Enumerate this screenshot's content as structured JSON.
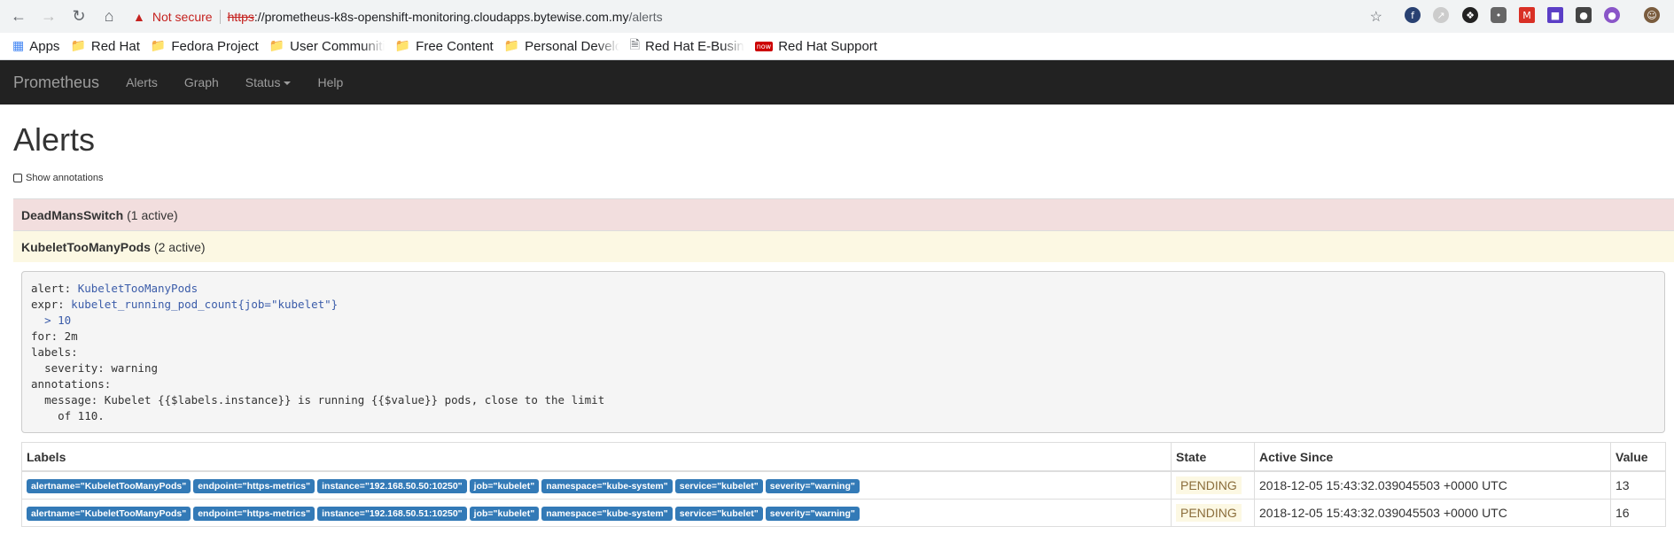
{
  "browser": {
    "warning_icon": "warning-triangle-icon",
    "not_secure": "Not secure",
    "url_scheme": "https",
    "url_host": "://prometheus-k8s-openshift-monitoring.cloudapps.bytewise.com.my",
    "url_path": "/alerts"
  },
  "bookmarks": [
    {
      "label": "Apps",
      "icon": "apps-grid-icon"
    },
    {
      "label": "Red Hat",
      "icon": "folder-icon"
    },
    {
      "label": "Fedora Project",
      "icon": "folder-icon"
    },
    {
      "label": "User Communiti",
      "icon": "folder-icon"
    },
    {
      "label": "Free Content",
      "icon": "folder-icon"
    },
    {
      "label": "Personal Develop",
      "icon": "folder-icon"
    },
    {
      "label": "Red Hat E-Busin",
      "icon": "page-icon"
    },
    {
      "label": "Red Hat Support",
      "icon": "redhat-now-icon"
    }
  ],
  "navbar": {
    "brand": "Prometheus",
    "links": [
      "Alerts",
      "Graph",
      "Status",
      "Help"
    ]
  },
  "page": {
    "title": "Alerts",
    "show_annotations": "Show annotations"
  },
  "groups": [
    {
      "name": "DeadMansSwitch",
      "count": "(1 active)"
    },
    {
      "name": "KubeletTooManyPods",
      "count": "(2 active)"
    }
  ],
  "rule": {
    "alert_key": "alert:",
    "alert_val": "KubeletTooManyPods",
    "expr_key": "expr:",
    "expr_val1": "kubelet_running_pod_count{job=\"kubelet\"}",
    "expr_val2": "> 10",
    "for": "for: 2m",
    "labels": "labels:",
    "severity": "severity: warning",
    "annotations": "annotations:",
    "message1": "message: Kubelet {{$labels.instance}} is running {{$value}} pods, close to the limit",
    "message2": "of 110."
  },
  "table": {
    "headers": [
      "Labels",
      "State",
      "Active Since",
      "Value"
    ],
    "rows": [
      {
        "labels": [
          "alertname=\"KubeletTooManyPods\"",
          "endpoint=\"https-metrics\"",
          "instance=\"192.168.50.50:10250\"",
          "job=\"kubelet\"",
          "namespace=\"kube-system\"",
          "service=\"kubelet\"",
          "severity=\"warning\""
        ],
        "state": "PENDING",
        "active_since": "2018-12-05 15:43:32.039045503 +0000 UTC",
        "value": "13"
      },
      {
        "labels": [
          "alertname=\"KubeletTooManyPods\"",
          "endpoint=\"https-metrics\"",
          "instance=\"192.168.50.51:10250\"",
          "job=\"kubelet\"",
          "namespace=\"kube-system\"",
          "service=\"kubelet\"",
          "severity=\"warning\""
        ],
        "state": "PENDING",
        "active_since": "2018-12-05 15:43:32.039045503 +0000 UTC",
        "value": "16"
      }
    ]
  }
}
